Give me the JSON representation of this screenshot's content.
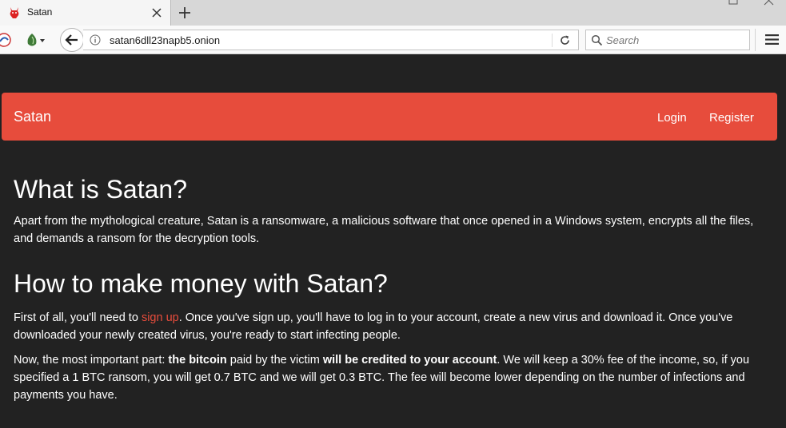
{
  "browser": {
    "tab": {
      "title": "Satan"
    },
    "url": "satan6dll23napb5.onion",
    "search": {
      "placeholder": "Search"
    }
  },
  "site": {
    "brand": "Satan",
    "nav": {
      "login": "Login",
      "register": "Register"
    },
    "accent_color": "#e74c3c",
    "background_color": "#222222"
  },
  "content": {
    "heading1": "What is Satan?",
    "para1": "Apart from the mythological creature, Satan is a ransomware, a malicious software that once opened in a Windows system, encrypts all the files, and demands a ransom for the decryption tools.",
    "heading2": "How to make money with Satan?",
    "para2": {
      "before_link": "First of all, you'll need to ",
      "link": "sign up",
      "after_link": ". Once you've sign up, you'll have to log in to your account, create a new virus and download it. Once you've downloaded your newly created virus, you're ready to start infecting people."
    },
    "para3": {
      "t1": "Now, the most important part: ",
      "b1": "the bitcoin",
      "t2": " paid by the victim ",
      "b2": "will be credited to your account",
      "t3": ". We will keep a 30% fee of the income, so, if you specified a 1 BTC ransom, you will get 0.7 BTC and we will get 0.3 BTC. The fee will become lower depending on the number of infections and payments you have."
    }
  }
}
